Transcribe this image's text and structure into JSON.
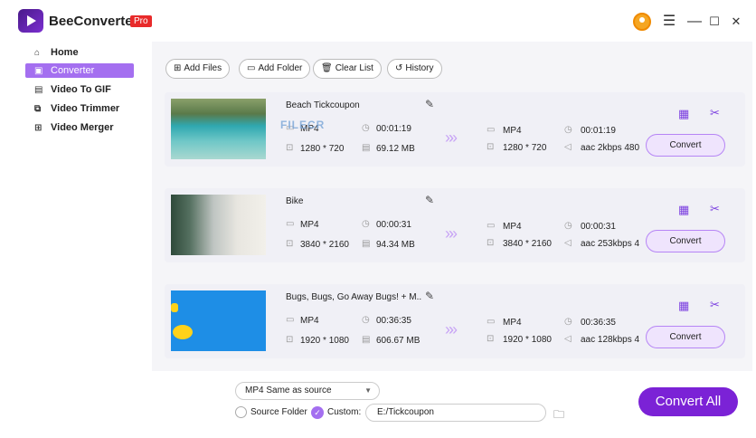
{
  "app": {
    "name": "BeeConverter",
    "badge": "Pro"
  },
  "window_controls": {
    "account": "user-icon",
    "menu": "☰",
    "minimize": "—",
    "maximize": "☐",
    "close": "✕"
  },
  "sidebar": {
    "items": [
      {
        "label": "Home",
        "icon": "⌂"
      },
      {
        "label": "Converter",
        "icon": "▣"
      },
      {
        "label": "Video To GIF",
        "icon": "▤"
      },
      {
        "label": "Video Trimmer",
        "icon": "⧉"
      },
      {
        "label": "Video Merger",
        "icon": "⊞"
      }
    ]
  },
  "toolbar": {
    "add_files": "Add Files",
    "add_folder": "Add Folder",
    "clear_list": "Clear List",
    "history": "History"
  },
  "watermark": "FILECR",
  "files": [
    {
      "name": "Beach Tickcoupon",
      "src_format": "MP4",
      "src_duration": "00:01:19",
      "src_resolution": "1280 * 720",
      "src_size": "69.12 MB",
      "out_format": "MP4",
      "out_duration": "00:01:19",
      "out_resolution": "1280 * 720",
      "out_audio": "aac 2kbps 480",
      "convert": "Convert"
    },
    {
      "name": "Bike",
      "src_format": "MP4",
      "src_duration": "00:00:31",
      "src_resolution": "3840 * 2160",
      "src_size": "94.34 MB",
      "out_format": "MP4",
      "out_duration": "00:00:31",
      "out_resolution": "3840 * 2160",
      "out_audio": "aac 253kbps 4",
      "convert": "Convert"
    },
    {
      "name": "Bugs, Bugs, Go Away Bugs! + M...",
      "src_format": "MP4",
      "src_duration": "00:36:35",
      "src_resolution": "1920 * 1080",
      "src_size": "606.67 MB",
      "out_format": "MP4",
      "out_duration": "00:36:35",
      "out_resolution": "1920 * 1080",
      "out_audio": "aac 128kbps 4",
      "convert": "Convert"
    }
  ],
  "bottom": {
    "format_select": "MP4 Same as source",
    "source_folder": "Source Folder",
    "custom": "Custom:",
    "output_path": "E:/Tickcoupon",
    "convert_all": "Convert All"
  }
}
